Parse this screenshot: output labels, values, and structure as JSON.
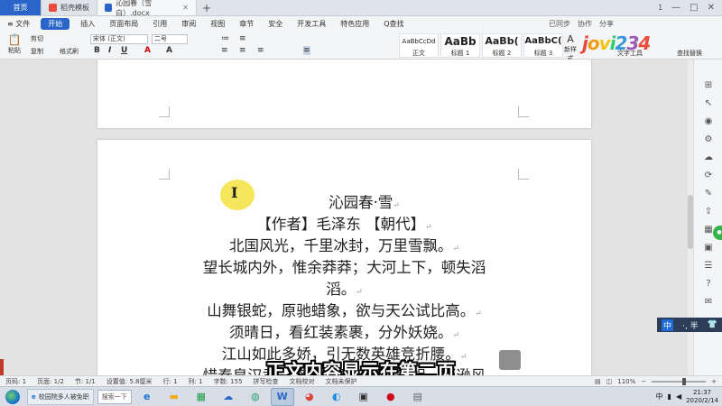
{
  "tabs": {
    "home": "首页",
    "template": "稻壳模板",
    "document": "沁园春（雪白）.docx",
    "plus": "+"
  },
  "window_controls": {
    "restore_label": "1",
    "minimize": "—",
    "maximize": "□",
    "close": "✕"
  },
  "menu": {
    "file": "≡ 文件",
    "start": "开始",
    "items": [
      "插入",
      "页面布局",
      "引用",
      "审阅",
      "视图",
      "章节",
      "安全",
      "开发工具",
      "特色应用"
    ],
    "find": "Q查找",
    "right_items": [
      "已同步",
      "协作",
      "分享"
    ]
  },
  "ribbon": {
    "paste": "粘贴",
    "cut": "剪切",
    "copy": "复制",
    "format_painter": "格式刷",
    "font_name": "宋体 (正文)",
    "font_size": "二号",
    "bold": "B",
    "italic": "I",
    "underline": "U",
    "styles": [
      {
        "preview": "AaBbCcDd",
        "label": "正文",
        "small": true
      },
      {
        "preview": "AaBb",
        "label": "标题 1",
        "small": false
      },
      {
        "preview": "AaBb(",
        "label": "标题 2",
        "small": false
      },
      {
        "preview": "AaBbC(",
        "label": "标题 3",
        "small": false
      }
    ],
    "new_style": "新样式",
    "text_tools": "文字工具",
    "find_replace": "查找替换"
  },
  "logo": {
    "letters": [
      "j",
      "o",
      "v",
      "i",
      "2",
      "3",
      "4"
    ],
    "colors": [
      "#e94b3c",
      "#f39c12",
      "#f1c40f",
      "#2ecc71",
      "#3498db",
      "#9b59b6",
      "#e74c3c"
    ]
  },
  "document": {
    "lines": [
      "沁园春·雪",
      "【作者】毛泽东 【朝代】",
      "北国风光，千里冰封，万里雪飘。",
      "望长城内外，惟余莽莽；大河上下，顿失滔",
      "滔。",
      "山舞银蛇，原驰蜡象，欲与天公试比高。",
      "须晴日，看红装素裹，分外妖娆。",
      "江山如此多娇，引无数英雄竞折腰。",
      "惜秦皇汉武，略输文采；唐宗宋祖，稍逊风"
    ],
    "paragraph_mark": "↵"
  },
  "cursor": {
    "glyph": "I"
  },
  "subtitle": "正文内容显示在第二页",
  "ime": {
    "lang": "中",
    "mode": "·, 半",
    "shirt": "👕"
  },
  "statusbar": {
    "page_number": "页码: 1",
    "pages": "页面: 1/2",
    "section": "节: 1/1",
    "settings": "设置值: 5.8厘米",
    "line": "行: 1",
    "column": "列: 1",
    "word_count": "字数: 155",
    "spell_check": "拼写检查",
    "doc_proof": "文档校对",
    "doc_protect": "文档未保护",
    "zoom": "110%"
  },
  "taskbar": {
    "window_title": "校园院多人被免职",
    "search_button": "搜索一下",
    "time": "21:37",
    "date": "2020/2/14",
    "tray_lang": "中"
  },
  "colors": {
    "accent": "#2a66c9",
    "highlight": "#f5e34a",
    "ime_bg": "#2c3e57"
  }
}
